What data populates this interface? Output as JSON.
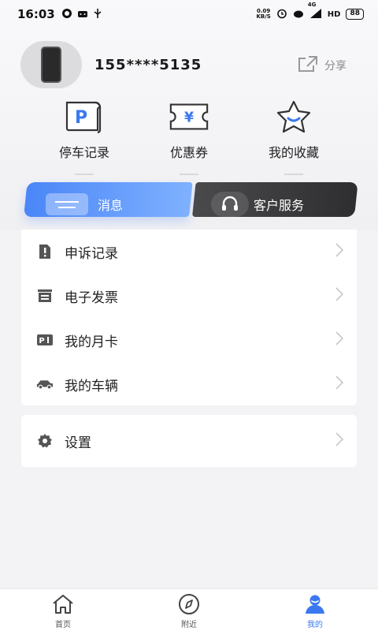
{
  "status_bar": {
    "time": "16:03",
    "net_speed_value": "0.09",
    "net_speed_unit": "KB/S",
    "network": "4G",
    "hd": "HD",
    "battery": "88"
  },
  "profile": {
    "phone": "155****5135",
    "share_label": "分享"
  },
  "quick_actions": [
    {
      "label": "停车记录",
      "icon": "parking-receipt-icon"
    },
    {
      "label": "优惠券",
      "icon": "coupon-icon"
    },
    {
      "label": "我的收藏",
      "icon": "star-icon"
    }
  ],
  "message_button": {
    "label": "消息"
  },
  "service_button": {
    "label": "客户服务"
  },
  "menu": [
    {
      "label": "申诉记录",
      "icon": "complaint-icon"
    },
    {
      "label": "电子发票",
      "icon": "invoice-icon"
    },
    {
      "label": "我的月卡",
      "icon": "monthly-card-icon"
    },
    {
      "label": "我的车辆",
      "icon": "car-icon"
    }
  ],
  "settings": {
    "label": "设置",
    "icon": "gear-icon"
  },
  "bottom_nav": [
    {
      "label": "首页",
      "icon": "home-icon",
      "active": false
    },
    {
      "label": "附近",
      "icon": "compass-icon",
      "active": false
    },
    {
      "label": "我的",
      "icon": "profile-icon",
      "active": true
    }
  ],
  "colors": {
    "accent": "#3b78f0",
    "message_gradient_start": "#4a86f7",
    "service_bg": "#3a3a3c"
  }
}
